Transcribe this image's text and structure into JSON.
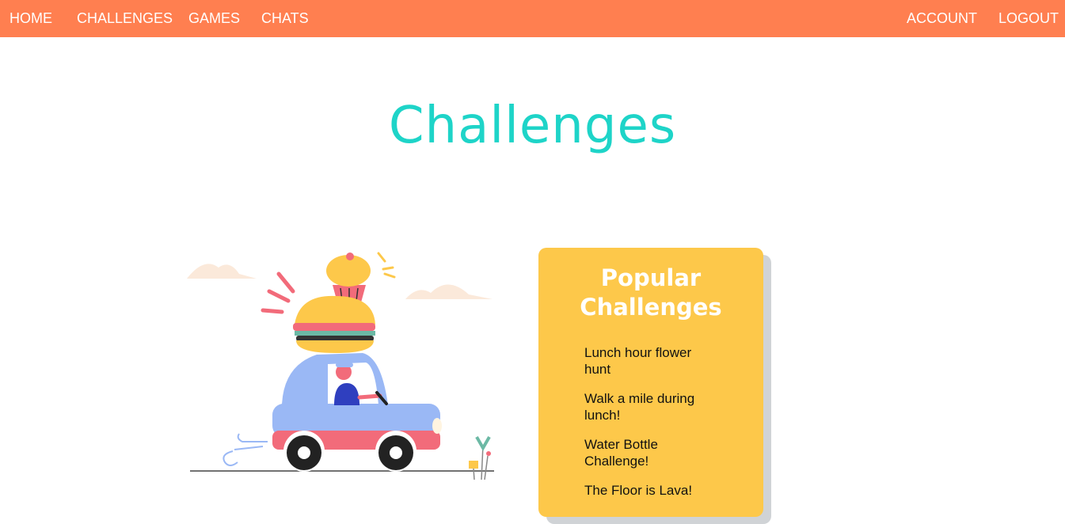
{
  "nav": {
    "left": [
      {
        "label": "HOME"
      },
      {
        "label": "CHALLENGES"
      },
      {
        "label": "GAMES"
      },
      {
        "label": "CHATS"
      }
    ],
    "right": [
      {
        "label": "ACCOUNT"
      },
      {
        "label": "LOGOUT"
      }
    ]
  },
  "page": {
    "title": "Challenges"
  },
  "popular": {
    "title_line1": "Popular",
    "title_line2": "Challenges",
    "items": [
      {
        "label": "Lunch hour flower hunt"
      },
      {
        "label": "Walk a mile during lunch!"
      },
      {
        "label": "Water Bottle Challenge!"
      },
      {
        "label": "The Floor is Lava!"
      }
    ]
  },
  "colors": {
    "nav_bg": "#ff7f50",
    "title": "#1ed4c8",
    "card_bg": "#fdc84a"
  },
  "icons": {
    "illustration": "car-with-burger-illustration"
  }
}
